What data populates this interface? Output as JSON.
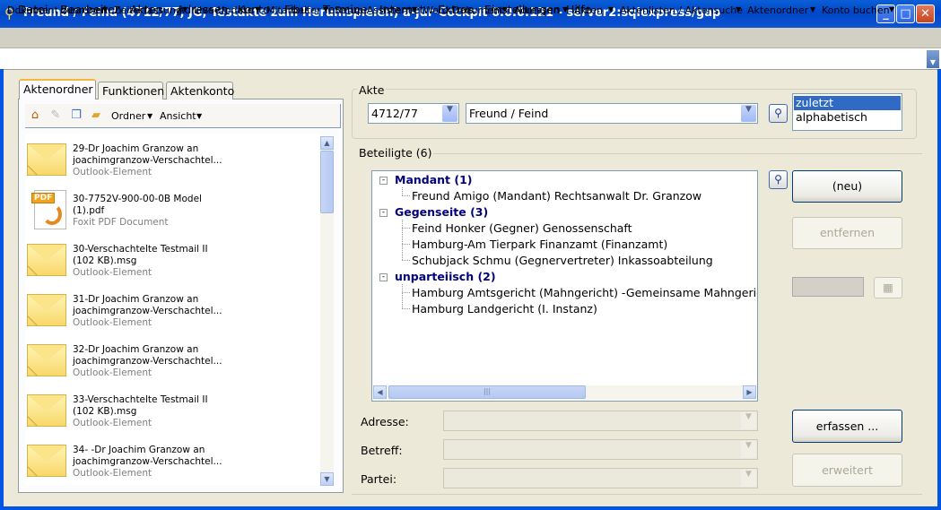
{
  "window": {
    "title": "Freund / Feind (4712/77, JG, Testakte zum Herumspielen) a-jur-Cockpit 6.0.0.121 - server2:sqlexpress/gap",
    "minimize": "_",
    "maximize": "□",
    "close": "✕"
  },
  "menubar": [
    "Datei",
    "Bearbeiten",
    "Akten",
    "Adressen",
    "Konto",
    "Fibu",
    "Termine",
    "Internet",
    "Extras",
    "Einstellungen",
    "Hilfe"
  ],
  "toolbar": [
    "Dokument zuordnen",
    "Zeiterfassung",
    "Live-Update",
    "Mitarbeiter",
    "Setup-Assistent",
    "Word-Dokument",
    "Adressen",
    "Akten",
    "Aktenlisten / Aktensuche",
    "Aktenordner",
    "Konto buchen"
  ],
  "left_tabs": [
    "Aktenordner",
    "Funktionen",
    "Aktenkonto"
  ],
  "left_toolbar": {
    "ordner": "Ordner",
    "ansicht": "Ansicht"
  },
  "files": [
    {
      "type": "mail",
      "line1": "29-Dr Joachim Granzow an",
      "line2": "joachimgranzow-Verschachtel...",
      "kind": "Outlook-Element"
    },
    {
      "type": "pdf",
      "line1": "30-7752V-900-00-0B Model",
      "line2": "(1).pdf",
      "kind": "Foxit PDF Document"
    },
    {
      "type": "mail",
      "line1": "30-Verschachtelte Testmail II",
      "line2": "(102 KB).msg",
      "kind": "Outlook-Element"
    },
    {
      "type": "mail",
      "line1": "31-Dr Joachim Granzow an",
      "line2": "joachimgranzow-Verschachtel...",
      "kind": "Outlook-Element"
    },
    {
      "type": "mail",
      "line1": "32-Dr Joachim Granzow an",
      "line2": "joachimgranzow-Verschachtel...",
      "kind": "Outlook-Element"
    },
    {
      "type": "mail",
      "line1": "33-Verschachtelte Testmail II",
      "line2": "(102 KB).msg",
      "kind": "Outlook-Element"
    },
    {
      "type": "mail",
      "line1": "34- -Dr Joachim Granzow an",
      "line2": "joachimgranzow-Verschachtel...",
      "kind": "Outlook-Element"
    }
  ],
  "akte": {
    "label": "Akte",
    "number": "4712/77",
    "name": "Freund / Feind",
    "sort_options": [
      "zuletzt",
      "alphabetisch"
    ]
  },
  "beteiligte": {
    "label": "Beteiligte (6)",
    "groups": [
      {
        "title": "Mandant (1)",
        "items": [
          "Freund Amigo (Mandant)  Rechtsanwalt Dr. Granzow"
        ]
      },
      {
        "title": "Gegenseite (3)",
        "items": [
          "Feind Honker (Gegner) Genossenschaft",
          "Hamburg-Am Tierpark Finanzamt (Finanzamt)",
          "Schubjack Schmu (Gegnervertreter)  Inkassoabteilung"
        ]
      },
      {
        "title": "unparteiisch (2)",
        "items": [
          "Hamburg Amtsgericht (Mahngericht) -Gemeinsame Mahngerichte",
          "Hamburg Landgericht (I. Instanz)"
        ]
      }
    ]
  },
  "buttons": {
    "neu": "(neu)",
    "entfernen": "entfernen",
    "erfassen": "erfassen ...",
    "erweitert": "erweitert"
  },
  "fields": {
    "adresse": "Adresse:",
    "betreff": "Betreff:",
    "partei": "Partei:"
  }
}
